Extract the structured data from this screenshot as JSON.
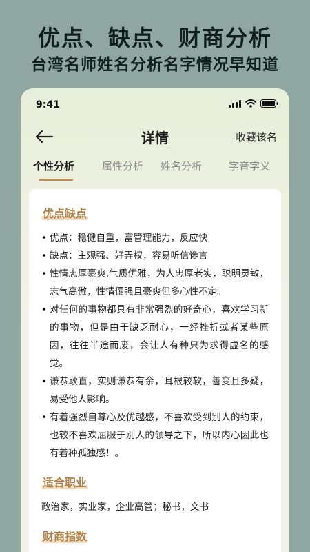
{
  "promo": {
    "title": "优点、缺点、财商分析",
    "subtitle": "台湾名师姓名分析名字情况早知道"
  },
  "status_bar": {
    "time": "9:41",
    "icons": [
      "signal-icon",
      "wifi-icon",
      "battery-icon"
    ]
  },
  "nav": {
    "back_icon": "back-arrow-icon",
    "title": "详情",
    "collect_label": "收藏该名"
  },
  "tabs": [
    {
      "label": "个性分析",
      "active": true
    },
    {
      "label": "属性分析",
      "active": false
    },
    {
      "label": "姓名分析",
      "active": false
    },
    {
      "label": "字音字义",
      "active": false
    }
  ],
  "sections": {
    "traits": {
      "title": "优点缺点",
      "items": [
        "优点：稳健自重，富管理能力，反应快",
        "缺点：主观强、好弄权，容易听信谗言",
        "性情忠厚豪爽,气质优雅，为人忠厚老实，聪明灵敏，志气高傲，性情倔强且豪爽但多心性不定。",
        "对任何的事物都具有非常强烈的好奇心，喜欢学习新的事物，但是由于缺乏耐心，一经挫折或者某些原因，往往半途而废，会让人有种只为求得虚名的感觉。",
        "谦恭耿直，实则谦恭有余，耳根较软，善变且多疑，易受他人影响。",
        "有着强烈自尊心及优越感，不喜欢受到别人的约束，也较不喜欢屈服于别人的领导之下，所以内心因此也有着种孤独感！。"
      ]
    },
    "career": {
      "title": "适合职业",
      "text": "政治家，实业家，企业高管；秘书，文书"
    },
    "finance": {
      "title": "财商指数"
    }
  },
  "colors": {
    "background": "#8fa6a1",
    "accent": "#b88a57",
    "section_title": "#b08249"
  }
}
